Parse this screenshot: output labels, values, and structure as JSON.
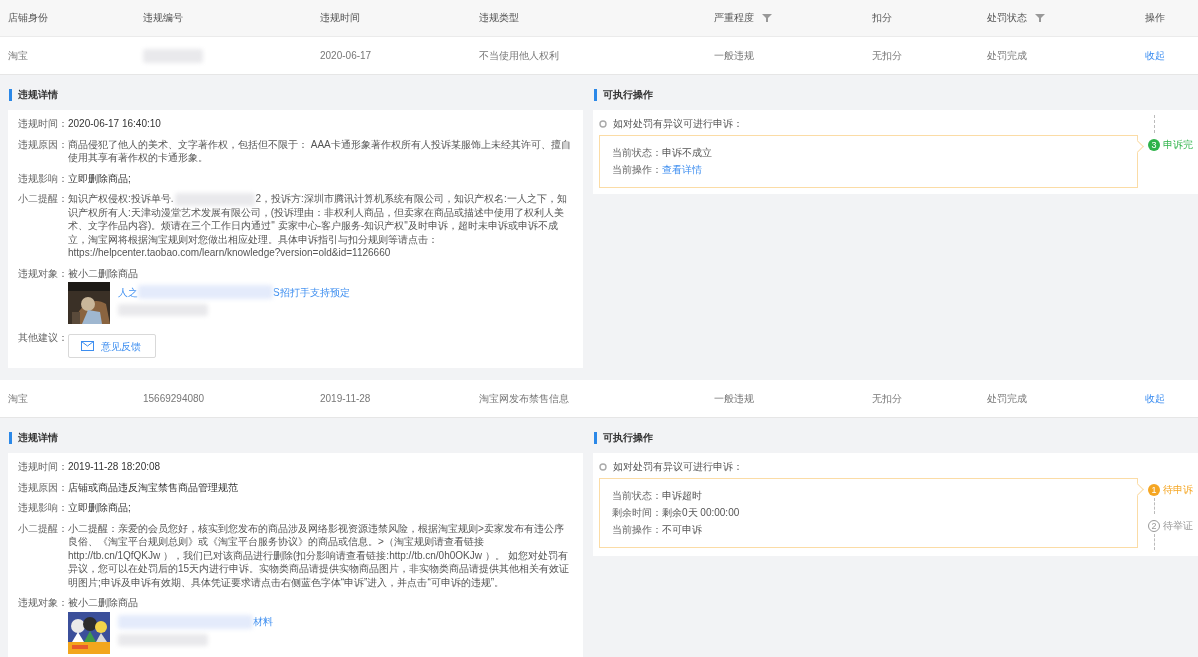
{
  "table": {
    "columns": [
      {
        "label": "店铺身份",
        "filter": false
      },
      {
        "label": "违规编号",
        "filter": false
      },
      {
        "label": "违规时间",
        "filter": false
      },
      {
        "label": "违规类型",
        "filter": false
      },
      {
        "label": "严重程度",
        "filter": true
      },
      {
        "label": "扣分",
        "filter": false
      },
      {
        "label": "处罚状态",
        "filter": true
      },
      {
        "label": "操作",
        "filter": false
      }
    ],
    "records": [
      {
        "cells": [
          {
            "kind": "text",
            "text": "淘宝"
          },
          {
            "kind": "redacted"
          },
          {
            "kind": "text",
            "text": "2020-06-17"
          },
          {
            "kind": "text",
            "text": "不当使用他人权利"
          },
          {
            "kind": "text",
            "text": "一般违规"
          },
          {
            "kind": "text",
            "text": "无扣分"
          },
          {
            "kind": "text",
            "text": "处罚完成"
          },
          {
            "kind": "link",
            "text": "收起"
          }
        ],
        "detail": {
          "title": "违规详情",
          "fields": [
            {
              "kind": "text",
              "label": "违规时间：",
              "value": "2020-06-17 16:40:10"
            },
            {
              "kind": "text",
              "label": "违规原因：",
              "value": "商品侵犯了他人的美术、文字著作权，包括但不限于： AAA卡通形象著作权所有人投诉某服饰上未经其许可、擅自使用其享有著作权的卡通形象。"
            },
            {
              "kind": "text",
              "label": "违规影响：",
              "value": "立即删除商品;"
            },
            {
              "kind": "parts",
              "label": "小二提醒：",
              "parts": [
                {
                  "kind": "text",
                  "text": "知识产权侵权:投诉单号."
                },
                {
                  "kind": "redacted"
                },
                {
                  "kind": "text",
                  "text": "2，投诉方:深圳市腾讯计算机系统有限公司，知识产权名:一人之下，知识产权所有人:天津动漫堂艺术发展有限公司，(投诉理由：非权利人商品，但卖家在商品或描述中使用了权利人美术、文字作品内容)。烦请在三个工作日内通过\" 卖家中心-客户服务-知识产权\"及时申诉，超时未申诉或申诉不成立，淘宝网将根据淘宝规则对您做出相应处理。具体申诉指引与扣分规则等请点击：https://helpcenter.taobao.com/learn/knowledge?version=old&id=1126660"
                }
              ]
            },
            {
              "kind": "product",
              "label": "违规对象：",
              "value": "被小二删除商品",
              "link_parts": [
                {
                  "kind": "text",
                  "text": "人之"
                },
                {
                  "kind": "redacted"
                },
                {
                  "kind": "text",
                  "text": "S招打手支持预定"
                }
              ]
            },
            {
              "kind": "button",
              "label": "其他建议：",
              "button": "意见反馈"
            }
          ]
        },
        "actions": {
          "title": "可执行操作",
          "hint": "如对处罚有异议可进行申诉：",
          "lines": [
            {
              "label": "当前状态：",
              "kind": "text",
              "value": "申诉不成立"
            },
            {
              "label": "当前操作：",
              "kind": "link",
              "value": "查看详情"
            }
          ],
          "steps": [
            {
              "number": "3",
              "label": "申诉完",
              "kind": "done"
            }
          ]
        }
      },
      {
        "cells": [
          {
            "kind": "text",
            "text": "淘宝"
          },
          {
            "kind": "text",
            "text": "15669294080"
          },
          {
            "kind": "text",
            "text": "2019-11-28"
          },
          {
            "kind": "text",
            "text": "淘宝网发布禁售信息"
          },
          {
            "kind": "text",
            "text": "一般违规"
          },
          {
            "kind": "text",
            "text": "无扣分"
          },
          {
            "kind": "text",
            "text": "处罚完成"
          },
          {
            "kind": "link",
            "text": "收起"
          }
        ],
        "detail": {
          "title": "违规详情",
          "fields": [
            {
              "kind": "text",
              "label": "违规时间：",
              "value": "2019-11-28 18:20:08"
            },
            {
              "kind": "text",
              "label": "违规原因：",
              "value": "店铺或商品违反淘宝禁售商品管理规范"
            },
            {
              "kind": "text",
              "label": "违规影响：",
              "value": "立即删除商品;"
            },
            {
              "kind": "text",
              "label": "小二提醒：",
              "value": "小二提醒：亲爱的会员您好，核实到您发布的商品涉及网络影视资源违禁风险，根据淘宝规则>卖家发布有违公序良俗、《淘宝平台规则总则》或《淘宝平台服务协议》的商品或信息。>（淘宝规则请查看链接http://tb.cn/1QfQKJw ），我们已对该商品进行删除(扣分影响请查看链接:http://tb.cn/0h0OKJw ）。 如您对处罚有异议，您可以在处罚后的15天内进行申诉。实物类商品请提供实物商品图片，非实物类商品请提供其他相关有效证明图片;申诉及申诉有效期、具体凭证要求请点击右侧蓝色字体“申诉”进入，并点击“可申诉的违规”。"
            },
            {
              "kind": "product",
              "label": "违规对象：",
              "value": "被小二删除商品",
              "link_parts": [
                {
                  "kind": "redacted"
                },
                {
                  "kind": "text",
                  "text": "材料"
                }
              ]
            }
          ]
        },
        "actions": {
          "title": "可执行操作",
          "hint": "如对处罚有异议可进行申诉：",
          "lines": [
            {
              "label": "当前状态：",
              "kind": "text",
              "value": "申诉超时"
            },
            {
              "label": "剩余时间：",
              "kind": "text",
              "value": "剩余0天 00:00:00"
            },
            {
              "label": "当前操作：",
              "kind": "text",
              "value": "不可申诉"
            }
          ],
          "steps": [
            {
              "number": "1",
              "label": "待申诉",
              "kind": "current"
            },
            {
              "number": "2",
              "label": "待举证",
              "kind": "pending"
            }
          ]
        }
      }
    ]
  }
}
